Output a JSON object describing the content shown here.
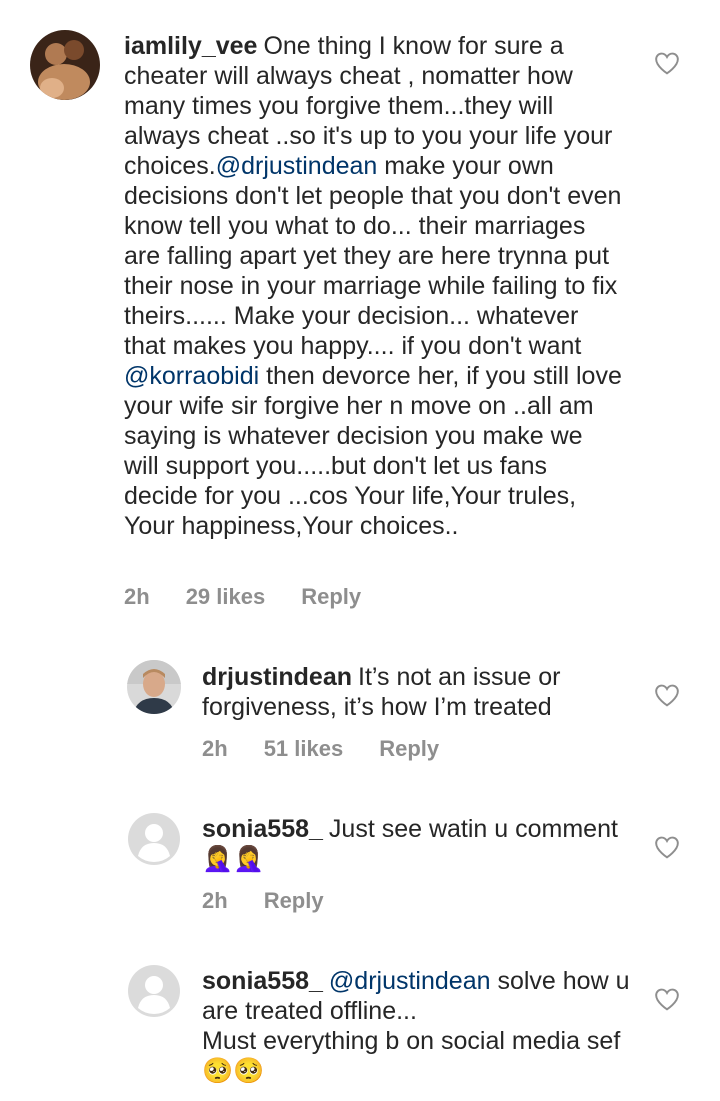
{
  "comments": [
    {
      "username": "iamlily_vee",
      "segments": [
        {
          "text": "One thing I know for sure a cheater will always cheat , nomatter how many times you forgive them...they will always cheat ..so it's up to you your life your choices."
        },
        {
          "text": "@drjustindean",
          "mention": true
        },
        {
          "text": " make your own decisions don't let people that you don't even know tell you what to do... their marriages are falling apart yet they are here trynna put their nose in your marriage while failing to fix theirs...... Make your decision... whatever that makes you happy.... if you don't want "
        },
        {
          "text": "@korraobidi",
          "mention": true
        },
        {
          "text": " then devorce her, if you still love your wife sir forgive her n move on ..all am saying is whatever decision you make we will support you.....but don't let us fans decide for you ...cos Your life,Your trules, Your happiness,Your choices.."
        }
      ],
      "time": "2h",
      "likes": "29 likes",
      "reply": "Reply",
      "avatar": "photo"
    },
    {
      "username": "drjustindean",
      "segments": [
        {
          "text": "It’s not an issue or forgiveness, it’s how I’m treated"
        }
      ],
      "time": "2h",
      "likes": "51 likes",
      "reply": "Reply",
      "avatar": "photo-man"
    },
    {
      "username": "sonia558_",
      "segments": [
        {
          "text": "Just see watin u comment🤦‍♀️🤦‍♀️"
        }
      ],
      "time": "2h",
      "likes": "",
      "reply": "Reply",
      "avatar": "default"
    },
    {
      "username": "sonia558_",
      "segments": [
        {
          "text": "@drjustindean",
          "mention": true
        },
        {
          "text": " solve how u are treated offline..."
        },
        {
          "text": "\nMust everything b on social media sef🥺🥺",
          "newline": true
        }
      ],
      "time": "",
      "likes": "",
      "reply": "",
      "avatar": "default"
    }
  ],
  "icons": {
    "like": "heart-outline-icon"
  },
  "colors": {
    "text": "#262626",
    "mention": "#003569",
    "meta": "#8e8e8e"
  }
}
